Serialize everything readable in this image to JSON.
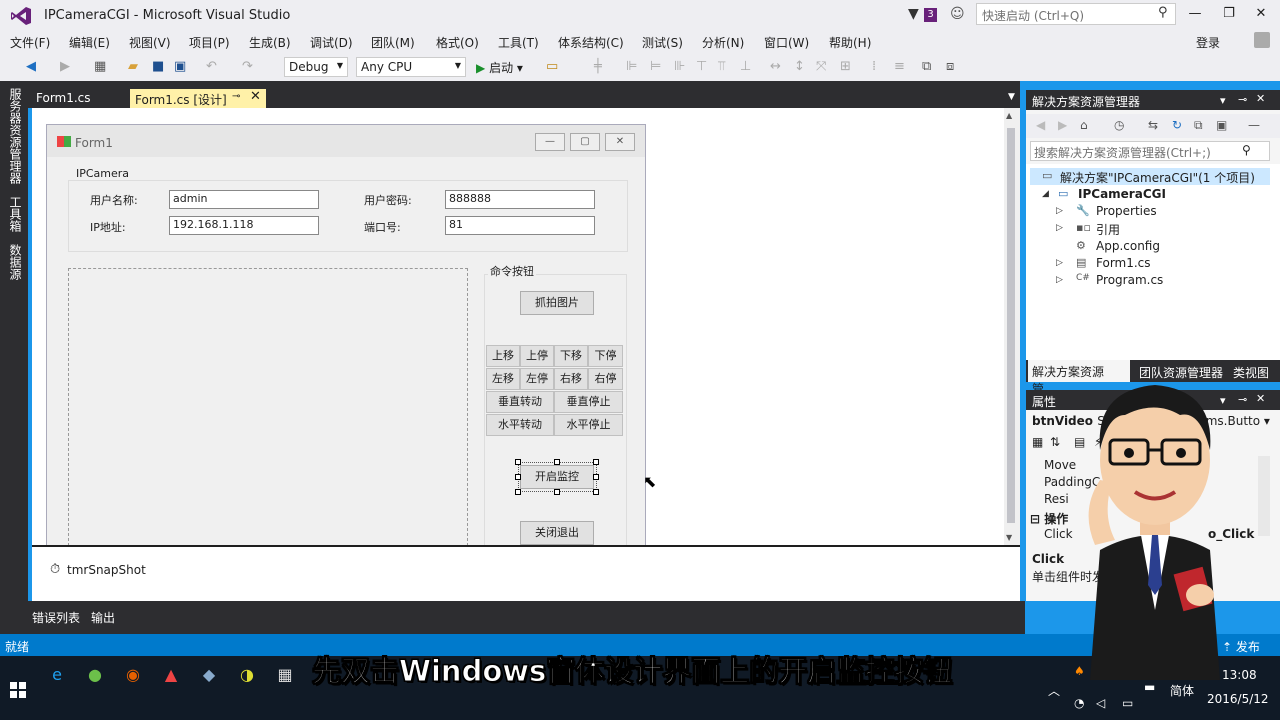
{
  "window": {
    "title": "IPCameraCGI - Microsoft Visual Studio",
    "notification_count": "3",
    "quick_launch_placeholder": "快速启动 (Ctrl+Q)",
    "login": "登录"
  },
  "menu": [
    "文件(F)",
    "编辑(E)",
    "视图(V)",
    "项目(P)",
    "生成(B)",
    "调试(D)",
    "团队(M)",
    "格式(O)",
    "工具(T)",
    "体系结构(C)",
    "测试(S)",
    "分析(N)",
    "窗口(W)",
    "帮助(H)"
  ],
  "toolbar": {
    "config": "Debug",
    "platform": "Any CPU",
    "start_label": "启动"
  },
  "left_tabs": [
    "服务器资源管理器",
    "工具箱",
    "数据源"
  ],
  "doc_tabs": {
    "tab1": "Form1.cs",
    "tab2": "Form1.cs [设计]"
  },
  "form": {
    "title": "Form1",
    "group_ipcamera": "IPCamera",
    "username_label": "用户名称:",
    "username_value": "admin",
    "password_label": "用户密码:",
    "password_value": "888888",
    "ip_label": "IP地址:",
    "ip_value": "192.168.1.118",
    "port_label": "端口号:",
    "port_value": "81",
    "group_cmd": "命令按钮",
    "snapshot_btn": "抓拍图片",
    "ptz": [
      "上移",
      "上停",
      "下移",
      "下停",
      "左移",
      "左停",
      "右移",
      "右停"
    ],
    "vertical_rotate": "垂直转动",
    "vertical_stop": "垂直停止",
    "horizontal_rotate": "水平转动",
    "horizontal_stop": "水平停止",
    "start_monitor_btn": "开启监控",
    "exit_btn": "关闭退出"
  },
  "tray": {
    "timer": "tmrSnapShot"
  },
  "bottom_tabs": {
    "errors": "错误列表",
    "output": "输出"
  },
  "solution_explorer": {
    "title": "解决方案资源管理器",
    "search_placeholder": "搜索解决方案资源管理器(Ctrl+;)",
    "solution": "解决方案\"IPCameraCGI\"(1 个项目)",
    "project": "IPCameraCGI",
    "items": [
      "Properties",
      "引用",
      "App.config",
      "Form1.cs",
      "Program.cs"
    ],
    "tabs": [
      "解决方案资源管...",
      "团队资源管理器",
      "类视图"
    ]
  },
  "properties": {
    "title": "属性",
    "object": "btnVideo",
    "object_type_prefix": "S",
    "object_type": "rms.Butto",
    "rows": [
      "Move",
      "PaddingC",
      "Resi"
    ],
    "category": "操作",
    "click_label": "Click",
    "click_value": "o_Click",
    "desc_name": "Click",
    "desc_text": "单击组件时发生"
  },
  "statusbar": {
    "status": "就绪",
    "publish": "发布"
  },
  "taskbar": {
    "ime": "简体",
    "time": "13:08",
    "date": "2016/5/12"
  },
  "subtitle": "先双击Windows窗体设计界面上的开启监控按钮",
  "colors": {
    "accent": "#007acc",
    "tab_active": "#fff1a8",
    "chrome_dark": "#2d2d30"
  }
}
